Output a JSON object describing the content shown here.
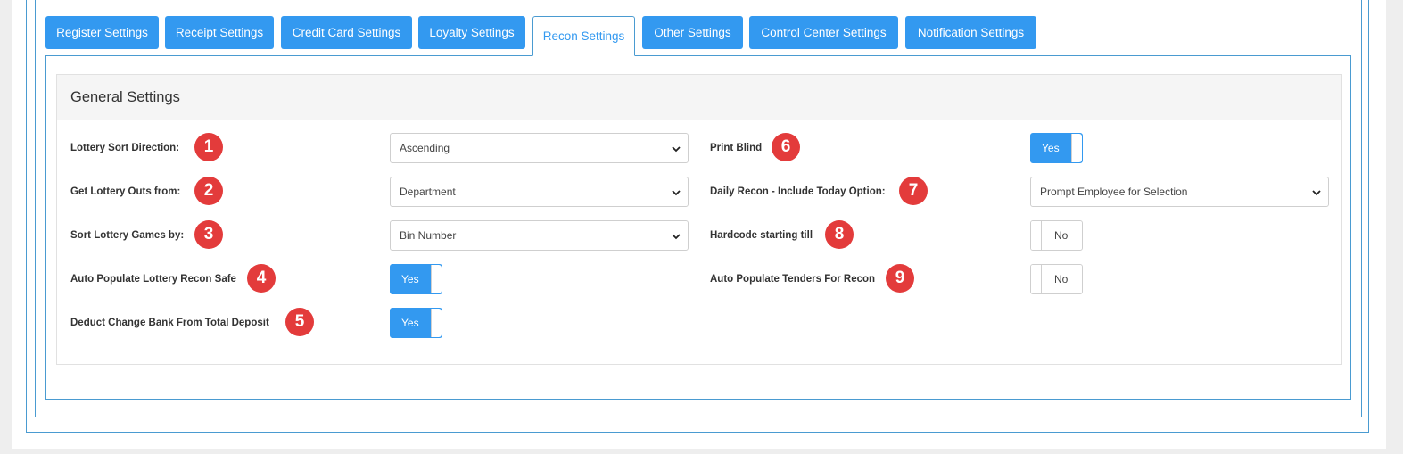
{
  "tabs": [
    {
      "label": "Register Settings",
      "active": false
    },
    {
      "label": "Receipt Settings",
      "active": false
    },
    {
      "label": "Credit Card Settings",
      "active": false
    },
    {
      "label": "Loyalty Settings",
      "active": false
    },
    {
      "label": "Recon Settings",
      "active": true
    },
    {
      "label": "Other Settings",
      "active": false
    },
    {
      "label": "Control Center Settings",
      "active": false
    },
    {
      "label": "Notification Settings",
      "active": false
    }
  ],
  "panel": {
    "title": "General Settings"
  },
  "left": [
    {
      "label": "Lottery Sort Direction:",
      "badge": "1",
      "type": "select",
      "value": "Ascending"
    },
    {
      "label": "Get Lottery Outs from:",
      "badge": "2",
      "type": "select",
      "value": "Department"
    },
    {
      "label": "Sort Lottery Games by:",
      "badge": "3",
      "type": "select",
      "value": "Bin Number"
    },
    {
      "label": "Auto Populate Lottery Recon Safe",
      "badge": "4",
      "type": "toggle",
      "value": "Yes"
    },
    {
      "label": "Deduct Change Bank From Total Deposit",
      "badge": "5",
      "type": "toggle",
      "value": "Yes"
    }
  ],
  "right": [
    {
      "label": "Print Blind",
      "badge": "6",
      "type": "toggle",
      "value": "Yes"
    },
    {
      "label": "Daily Recon - Include Today Option:",
      "badge": "7",
      "type": "select",
      "value": "Prompt Employee for Selection"
    },
    {
      "label": "Hardcode starting till",
      "badge": "8",
      "type": "toggle",
      "value": "No"
    },
    {
      "label": "Auto Populate Tenders For Recon",
      "badge": "9",
      "type": "toggle",
      "value": "No"
    }
  ],
  "colors": {
    "accent": "#3399f0",
    "badge": "#e33b3b",
    "frame": "#4a9bd1"
  },
  "icons": {
    "select_arrow": "chevron-down-icon"
  }
}
